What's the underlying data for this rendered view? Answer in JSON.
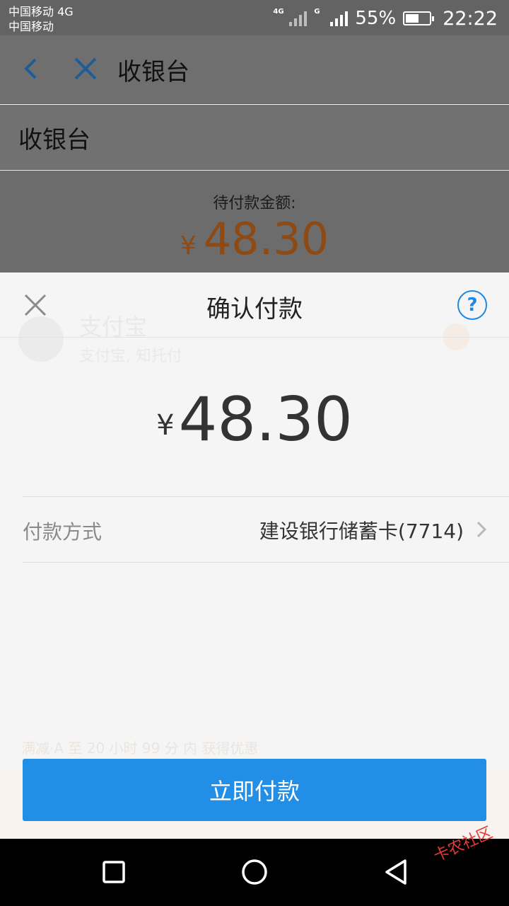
{
  "status_bar": {
    "carrier_line1": "中国移动 4G",
    "carrier_line2": "中国移动",
    "network_1": "4G",
    "network_2": "G",
    "battery_percent": "55%",
    "battery_level": 0.55,
    "time": "22:22"
  },
  "app_bar": {
    "title": "收银台",
    "back_icon": "chevron-left-icon",
    "close_icon": "close-icon",
    "icon_color": "#1e5d96"
  },
  "page": {
    "heading": "收银台",
    "amount_label": "待付款金额:",
    "currency": "¥",
    "amount": "48.30",
    "amount_color": "#8e4a12"
  },
  "background_list": {
    "name": "支付宝",
    "subtitle": "支付宝, 知托付",
    "promo": "满减·A 至 20 小时 99 分 内 获得优惠"
  },
  "sheet": {
    "title": "确认付款",
    "help": "?",
    "currency": "¥",
    "amount": "48.30",
    "payment_method_label": "付款方式",
    "payment_method_value": "建设银行储蓄卡(7714)",
    "pay_button": "立即付款",
    "accent": "#228ee6"
  },
  "nav_bar": {
    "recent_icon": "square-icon",
    "home_icon": "circle-icon",
    "back_icon": "triangle-back-icon",
    "watermark": "卡农社区"
  }
}
